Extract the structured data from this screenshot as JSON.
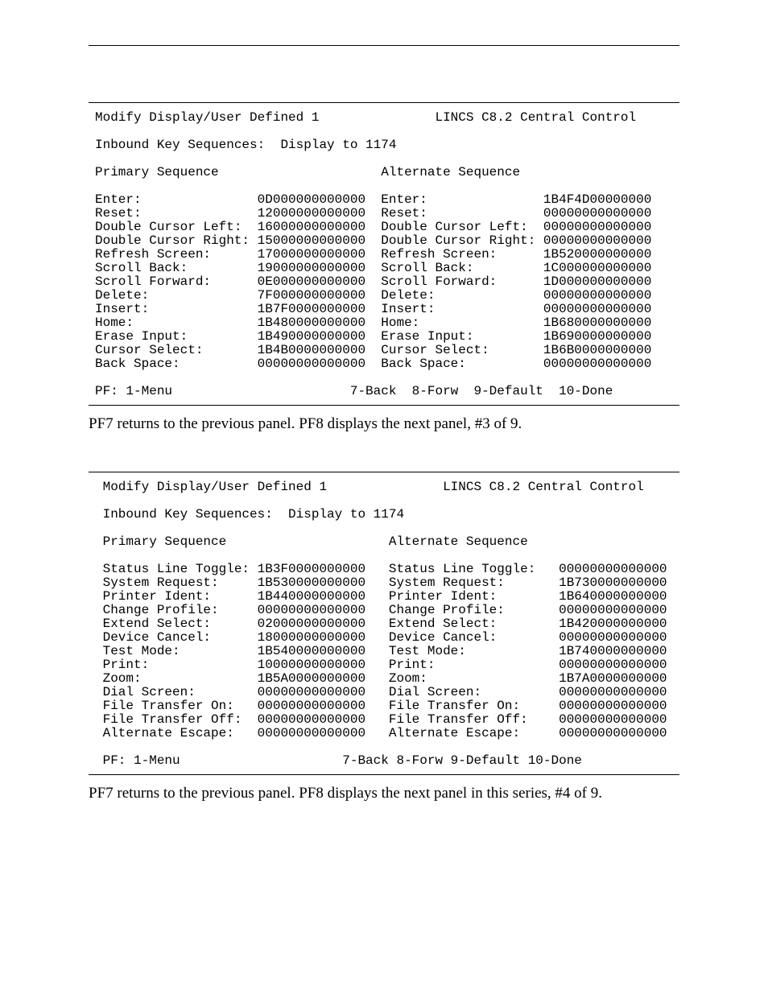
{
  "panel2": {
    "title_left": "Modify Display/User Defined 1",
    "title_right": "LINCS C8.2 Central Control",
    "subtitle": "Inbound Key Sequences:  Display to 1174",
    "col1_header": "Primary Sequence",
    "col2_header": "Alternate Sequence",
    "primary": [
      {
        "label": "Enter:",
        "value": "0D000000000000"
      },
      {
        "label": "Reset:",
        "value": "12000000000000"
      },
      {
        "label": "Double Cursor Left:",
        "value": "16000000000000"
      },
      {
        "label": "Double Cursor Right:",
        "value": "15000000000000"
      },
      {
        "label": "Refresh Screen:",
        "value": "17000000000000"
      },
      {
        "label": "Scroll Back:",
        "value": "19000000000000"
      },
      {
        "label": "Scroll Forward:",
        "value": "0E000000000000"
      },
      {
        "label": "Delete:",
        "value": "7F000000000000"
      },
      {
        "label": "Insert:",
        "value": "1B7F0000000000"
      },
      {
        "label": "Home:",
        "value": "1B480000000000"
      },
      {
        "label": "Erase Input:",
        "value": "1B490000000000"
      },
      {
        "label": "Cursor Select:",
        "value": "1B4B0000000000"
      },
      {
        "label": "Back Space:",
        "value": "00000000000000"
      }
    ],
    "alternate": [
      {
        "label": "Enter:",
        "value": "1B4F4D00000000"
      },
      {
        "label": "Reset:",
        "value": "00000000000000"
      },
      {
        "label": "Double Cursor Left:",
        "value": "00000000000000"
      },
      {
        "label": "Double Cursor Right:",
        "value": "00000000000000"
      },
      {
        "label": "Refresh Screen:",
        "value": "1B520000000000"
      },
      {
        "label": "Scroll Back:",
        "value": "1C000000000000"
      },
      {
        "label": "Scroll Forward:",
        "value": "1D000000000000"
      },
      {
        "label": "Delete:",
        "value": "00000000000000"
      },
      {
        "label": "Insert:",
        "value": "00000000000000"
      },
      {
        "label": "Home:",
        "value": "1B680000000000"
      },
      {
        "label": "Erase Input:",
        "value": "1B690000000000"
      },
      {
        "label": "Cursor Select:",
        "value": "1B6B0000000000"
      },
      {
        "label": "Back Space:",
        "value": "00000000000000"
      }
    ],
    "footer": "PF: 1-Menu                       7-Back  8-Forw  9-Default  10-Done",
    "text": "Modify Display/User Defined 1               LINCS C8.2 Central Control\n\nInbound Key Sequences:  Display to 1174\n\nPrimary Sequence                     Alternate Sequence\n\nEnter:               0D000000000000  Enter:               1B4F4D00000000\nReset:               12000000000000  Reset:               00000000000000\nDouble Cursor Left:  16000000000000  Double Cursor Left:  00000000000000\nDouble Cursor Right: 15000000000000  Double Cursor Right: 00000000000000\nRefresh Screen:      17000000000000  Refresh Screen:      1B520000000000\nScroll Back:         19000000000000  Scroll Back:         1C000000000000\nScroll Forward:      0E000000000000  Scroll Forward:      1D000000000000\nDelete:              7F000000000000  Delete:              00000000000000\nInsert:              1B7F0000000000  Insert:              00000000000000\nHome:                1B480000000000  Home:                1B680000000000\nErase Input:         1B490000000000  Erase Input:         1B690000000000\nCursor Select:       1B4B0000000000  Cursor Select:       1B6B0000000000\nBack Space:          00000000000000  Back Space:          00000000000000\n\nPF: 1-Menu                       7-Back  8-Forw  9-Default  10-Done"
  },
  "caption2": "PF7 returns to the previous panel. PF8 displays the next panel, #3 of 9.",
  "panel3": {
    "title_left": "Modify Display/User Defined 1",
    "title_right": "LINCS C8.2 Central Control",
    "subtitle": "Inbound Key Sequences:  Display to 1174",
    "col1_header": "Primary Sequence",
    "col2_header": "Alternate Sequence",
    "primary": [
      {
        "label": "Status Line Toggle:",
        "value": "1B3F0000000000"
      },
      {
        "label": "System Request:",
        "value": "1B530000000000"
      },
      {
        "label": "Printer Ident:",
        "value": "1B440000000000"
      },
      {
        "label": "Change Profile:",
        "value": "00000000000000"
      },
      {
        "label": "Extend Select:",
        "value": "02000000000000"
      },
      {
        "label": "Device Cancel:",
        "value": "18000000000000"
      },
      {
        "label": "Test Mode:",
        "value": "1B540000000000"
      },
      {
        "label": "Print:",
        "value": "10000000000000"
      },
      {
        "label": "Zoom:",
        "value": "1B5A0000000000"
      },
      {
        "label": "Dial Screen:",
        "value": "00000000000000"
      },
      {
        "label": "File Transfer On:",
        "value": "00000000000000"
      },
      {
        "label": "File Transfer Off:",
        "value": "00000000000000"
      },
      {
        "label": "Alternate Escape:",
        "value": "00000000000000"
      }
    ],
    "alternate": [
      {
        "label": "Status Line Toggle:",
        "value": "00000000000000"
      },
      {
        "label": "System Request:",
        "value": "1B730000000000"
      },
      {
        "label": "Printer Ident:",
        "value": "1B640000000000"
      },
      {
        "label": "Change Profile:",
        "value": "00000000000000"
      },
      {
        "label": "Extend Select:",
        "value": "1B420000000000"
      },
      {
        "label": "Device Cancel:",
        "value": "00000000000000"
      },
      {
        "label": "Test Mode:",
        "value": "1B740000000000"
      },
      {
        "label": "Print:",
        "value": "00000000000000"
      },
      {
        "label": "Zoom:",
        "value": "1B7A0000000000"
      },
      {
        "label": "Dial Screen:",
        "value": "00000000000000"
      },
      {
        "label": "File Transfer On:",
        "value": "00000000000000"
      },
      {
        "label": "File Transfer Off:",
        "value": "00000000000000"
      },
      {
        "label": "Alternate Escape:",
        "value": "00000000000000"
      }
    ],
    "footer": "PF: 1-Menu                     7-Back 8-Forw 9-Default 10-Done",
    "text": " Modify Display/User Defined 1               LINCS C8.2 Central Control\n\n Inbound Key Sequences:  Display to 1174\n\n Primary Sequence                     Alternate Sequence\n\n Status Line Toggle: 1B3F0000000000   Status Line Toggle:   00000000000000\n System Request:     1B530000000000   System Request:       1B730000000000\n Printer Ident:      1B440000000000   Printer Ident:        1B640000000000\n Change Profile:     00000000000000   Change Profile:       00000000000000\n Extend Select:      02000000000000   Extend Select:        1B420000000000\n Device Cancel:      18000000000000   Device Cancel:        00000000000000\n Test Mode:          1B540000000000   Test Mode:            1B740000000000\n Print:              10000000000000   Print:                00000000000000\n Zoom:               1B5A0000000000   Zoom:                 1B7A0000000000\n Dial Screen:        00000000000000   Dial Screen:          00000000000000\n File Transfer On:   00000000000000   File Transfer On:     00000000000000\n File Transfer Off:  00000000000000   File Transfer Off:    00000000000000\n Alternate Escape:   00000000000000   Alternate Escape:     00000000000000\n\n PF: 1-Menu                     7-Back 8-Forw 9-Default 10-Done"
  },
  "caption3": "PF7 returns to the previous panel. PF8 displays the next panel in this series, #4 of 9."
}
